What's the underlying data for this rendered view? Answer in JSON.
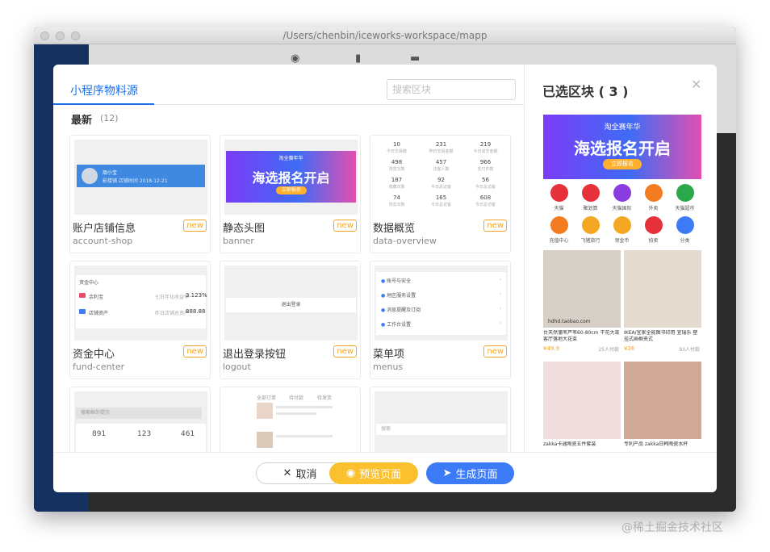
{
  "window": {
    "title": "/Users/chenbin/iceworks-workspace/mapp"
  },
  "modal": {
    "tab_label": "小程序物料源",
    "search_placeholder": "搜索区块",
    "section_title": "最新",
    "section_count": "(12)",
    "cards": [
      {
        "name": "账户店铺信息",
        "sub": "account-shop",
        "badge": "new"
      },
      {
        "name": "静态头图",
        "sub": "banner",
        "badge": "new"
      },
      {
        "name": "数据概览",
        "sub": "data-overview",
        "badge": "new"
      },
      {
        "name": "资金中心",
        "sub": "fund-center",
        "badge": "new"
      },
      {
        "name": "退出登录按钮",
        "sub": "logout",
        "badge": "new"
      },
      {
        "name": "菜单项",
        "sub": "menus",
        "badge": "new"
      }
    ],
    "previews": {
      "account_name": "周小宝",
      "account_meta": "影楼铺  店铺时间  2018-12-21",
      "banner_tag": "淘全赛年华",
      "banner_title": "海选报名开启",
      "banner_btn": "立即报名",
      "overview_rows": [
        [
          {
            "v": "10",
            "l": "今日交易数"
          },
          {
            "v": "231",
            "l": "昨日交易金额"
          },
          {
            "v": "219",
            "l": "今日成交金额"
          }
        ],
        [
          {
            "v": "498",
            "l": "浏览次数"
          },
          {
            "v": "457",
            "l": "访客人数"
          },
          {
            "v": "966",
            "l": "支付件数"
          }
        ],
        [
          {
            "v": "187",
            "l": "收藏次数"
          },
          {
            "v": "92",
            "l": "今日总访客"
          },
          {
            "v": "56",
            "l": "今日总访客"
          }
        ],
        [
          {
            "v": "74",
            "l": "浏览次数"
          },
          {
            "v": "165",
            "l": "今日总访客"
          },
          {
            "v": "608",
            "l": "今日总访客"
          }
        ]
      ],
      "fund_title": "资金中心",
      "fund_rows": [
        {
          "label": "余利宝",
          "desc": "七日年化收益率",
          "value": "3.123%"
        },
        {
          "label": "店铺资产",
          "desc": "昨日店铺总资产",
          "value": "888.88"
        }
      ],
      "logout_label": "退出登录",
      "menu_items": [
        "账号与安全",
        "地区服务设置",
        "消息提醒及订阅",
        "工作台设置"
      ],
      "row3_search": "搜索框的提示",
      "row3_values": [
        "891",
        "123",
        "461"
      ],
      "row3_tabs": [
        "全部订单",
        "待付款",
        "待发货"
      ],
      "row3_search_b": "搜索"
    },
    "right": {
      "title": "已选区块 ( 3 )",
      "banner_tag": "淘全赛年华",
      "banner_title": "海选报名开启",
      "banner_btn": "立即报名",
      "icons": [
        {
          "label": "天猫",
          "color": "#e6313a"
        },
        {
          "label": "聚划算",
          "color": "#e6313a"
        },
        {
          "label": "天猫国际",
          "color": "#8a3ce0"
        },
        {
          "label": "外卖",
          "color": "#f47c20"
        },
        {
          "label": "天猫超市",
          "color": "#2aa84a"
        },
        {
          "label": "充值中心",
          "color": "#f47c20"
        },
        {
          "label": "飞猪旅行",
          "color": "#f5a623"
        },
        {
          "label": "领金币",
          "color": "#f5a623"
        },
        {
          "label": "拍卖",
          "color": "#e6313a"
        },
        {
          "label": "分类",
          "color": "#3d7bf6"
        }
      ],
      "products": [
        {
          "title": "台天然蒲苇芦苇60-80cm 干花大束客厅落地大花束",
          "price": "¥49.9",
          "sold": "25人付款",
          "bg": "#d7d0c6"
        },
        {
          "title": "IKEA/宜家全能图书印用 宜瑞乐 壁挂式画框夹式",
          "price": "¥26",
          "sold": "93人付款",
          "bg": "#e4dacf"
        },
        {
          "title": "zakka卡通陶瓷五件套装",
          "price": "",
          "sold": "",
          "bg": "#f2dede"
        },
        {
          "title": "专利产品 zakka日韩陶瓷水杯",
          "price": "",
          "sold": "",
          "bg": "#cfa898"
        }
      ],
      "watermark_on_img": "hdhd.taobao.com"
    },
    "buttons": {
      "cancel": "取消",
      "preview": "预览页面",
      "generate": "生成页面"
    }
  },
  "watermark": "@稀土掘金技术社区"
}
